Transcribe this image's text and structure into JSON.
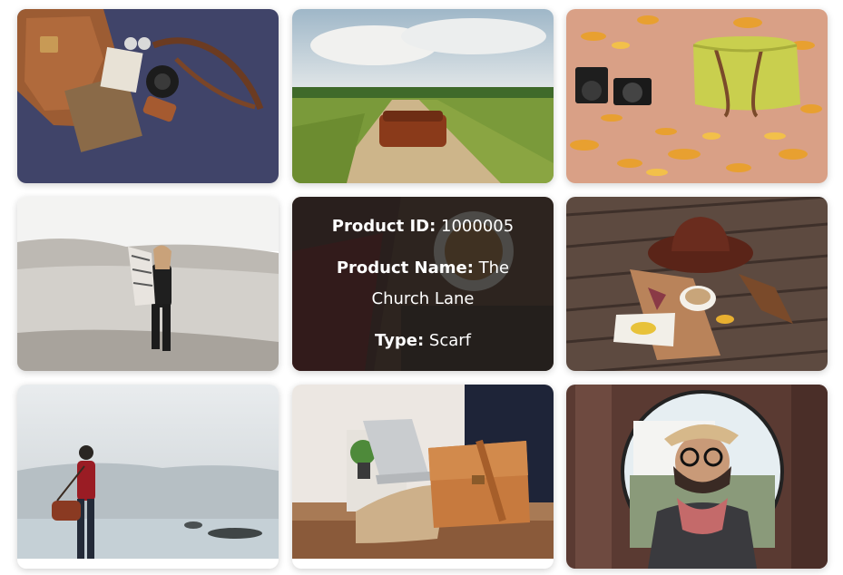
{
  "products": [
    {
      "id": 1,
      "scene": "leather satchel with camera and accessories on navy"
    },
    {
      "id": 2,
      "scene": "brown bag on grassy dirt road"
    },
    {
      "id": 3,
      "scene": "two cameras and green bag on autumn leaves"
    },
    {
      "id": 4,
      "scene": "woman with scarf walking on beach"
    },
    {
      "id": 5,
      "scene": "coffee cup and scarf (hover overlay)"
    },
    {
      "id": 6,
      "scene": "hat, coffee cup and leaves on wooden deck"
    },
    {
      "id": 7,
      "scene": "man with red bag by misty lake"
    },
    {
      "id": 8,
      "scene": "laptop and tan leather messenger bag"
    },
    {
      "id": 9,
      "scene": "man in hat and glasses in round mirror"
    }
  ],
  "hover_card": {
    "id_label": "Product ID:",
    "id_value": "1000005",
    "name_label": "Product Name:",
    "name_value": "The Church Lane",
    "type_label": "Type:",
    "type_value": "Scarf"
  }
}
